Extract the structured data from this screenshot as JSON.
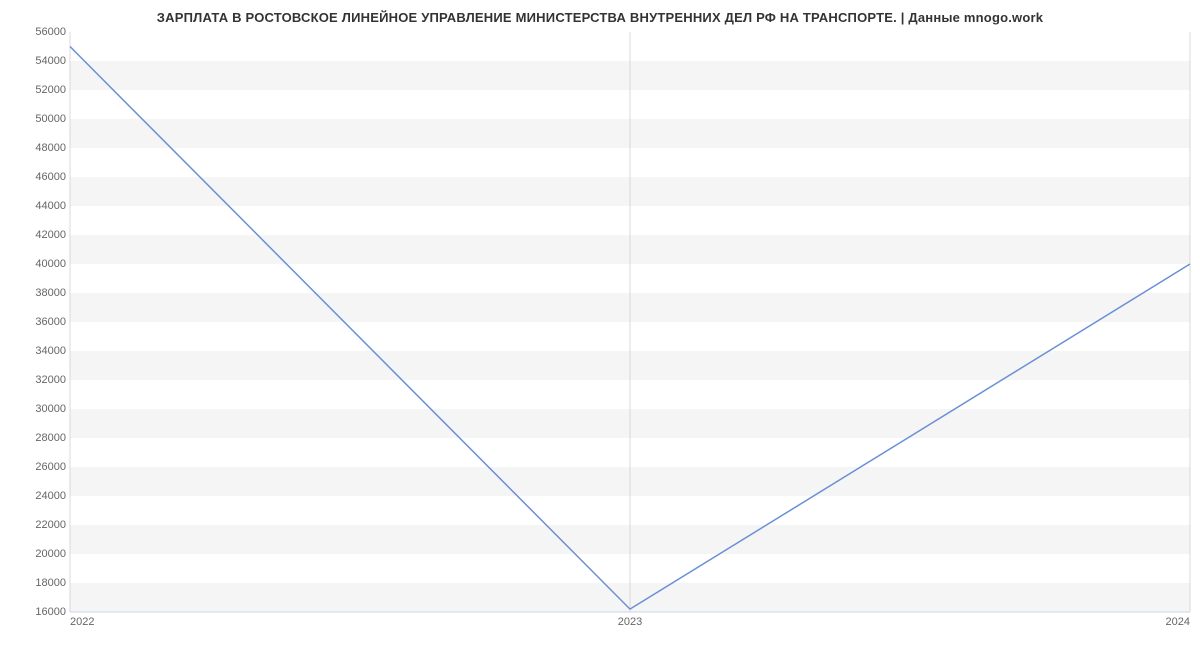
{
  "chart_data": {
    "type": "line",
    "title": "ЗАРПЛАТА В РОСТОВСКОЕ ЛИНЕЙНОЕ УПРАВЛЕНИЕ МИНИСТЕРСТВА  ВНУТРЕННИХ ДЕЛ РФ НА ТРАНСПОРТЕ. | Данные mnogo.work",
    "xlabel": "",
    "ylabel": "",
    "x_categories": [
      "2022",
      "2023",
      "2024"
    ],
    "y_ticks": [
      16000,
      18000,
      20000,
      22000,
      24000,
      26000,
      28000,
      30000,
      32000,
      34000,
      36000,
      38000,
      40000,
      42000,
      44000,
      46000,
      48000,
      50000,
      52000,
      54000,
      56000
    ],
    "ylim": [
      16000,
      56000
    ],
    "series": [
      {
        "name": "Зарплата",
        "x": [
          2022,
          2023,
          2024
        ],
        "values": [
          55000,
          16200,
          40000
        ]
      }
    ],
    "line_color": "#6a8fd8"
  }
}
